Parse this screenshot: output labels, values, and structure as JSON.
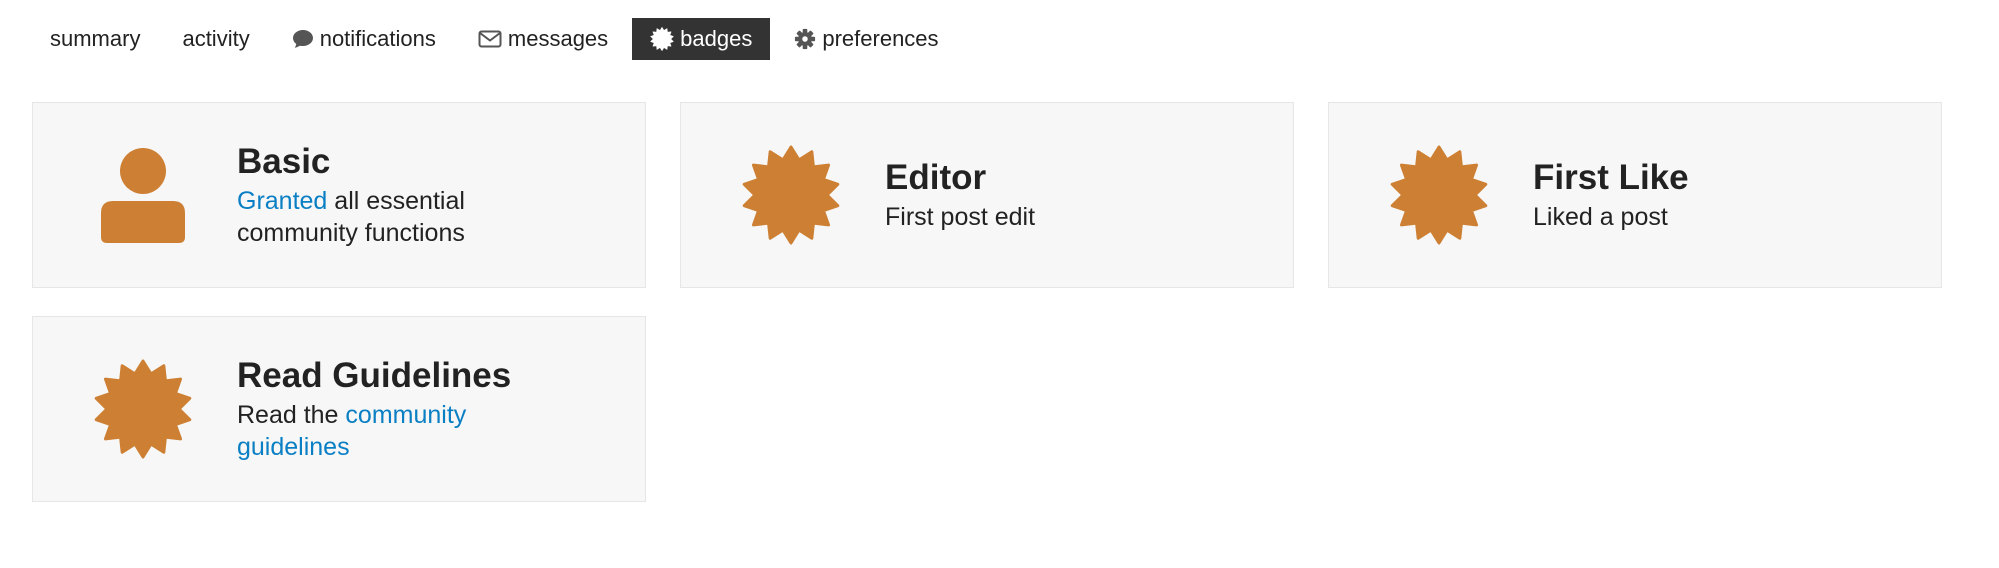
{
  "nav": {
    "tabs": [
      {
        "label": "summary",
        "icon": null,
        "active": false
      },
      {
        "label": "activity",
        "icon": null,
        "active": false
      },
      {
        "label": "notifications",
        "icon": "comment-icon",
        "active": false
      },
      {
        "label": "messages",
        "icon": "envelope-icon",
        "active": false
      },
      {
        "label": "badges",
        "icon": "badge-icon",
        "active": true
      },
      {
        "label": "preferences",
        "icon": "gear-icon",
        "active": false
      }
    ]
  },
  "colors": {
    "badge_bronze": "#cd8033",
    "link": "#0a7fc4",
    "active_tab_bg": "#333333",
    "card_bg": "#f7f7f7"
  },
  "badges": [
    {
      "title": "Basic",
      "icon": "user-icon",
      "desc_link": "Granted",
      "desc_rest": " all essential community functions"
    },
    {
      "title": "Editor",
      "icon": "badge-icon",
      "desc": "First post edit"
    },
    {
      "title": "First Like",
      "icon": "badge-icon",
      "desc": "Liked a post"
    },
    {
      "title": "Read Guidelines",
      "icon": "badge-icon",
      "desc_prefix": "Read the ",
      "desc_link": "community guidelines"
    }
  ]
}
